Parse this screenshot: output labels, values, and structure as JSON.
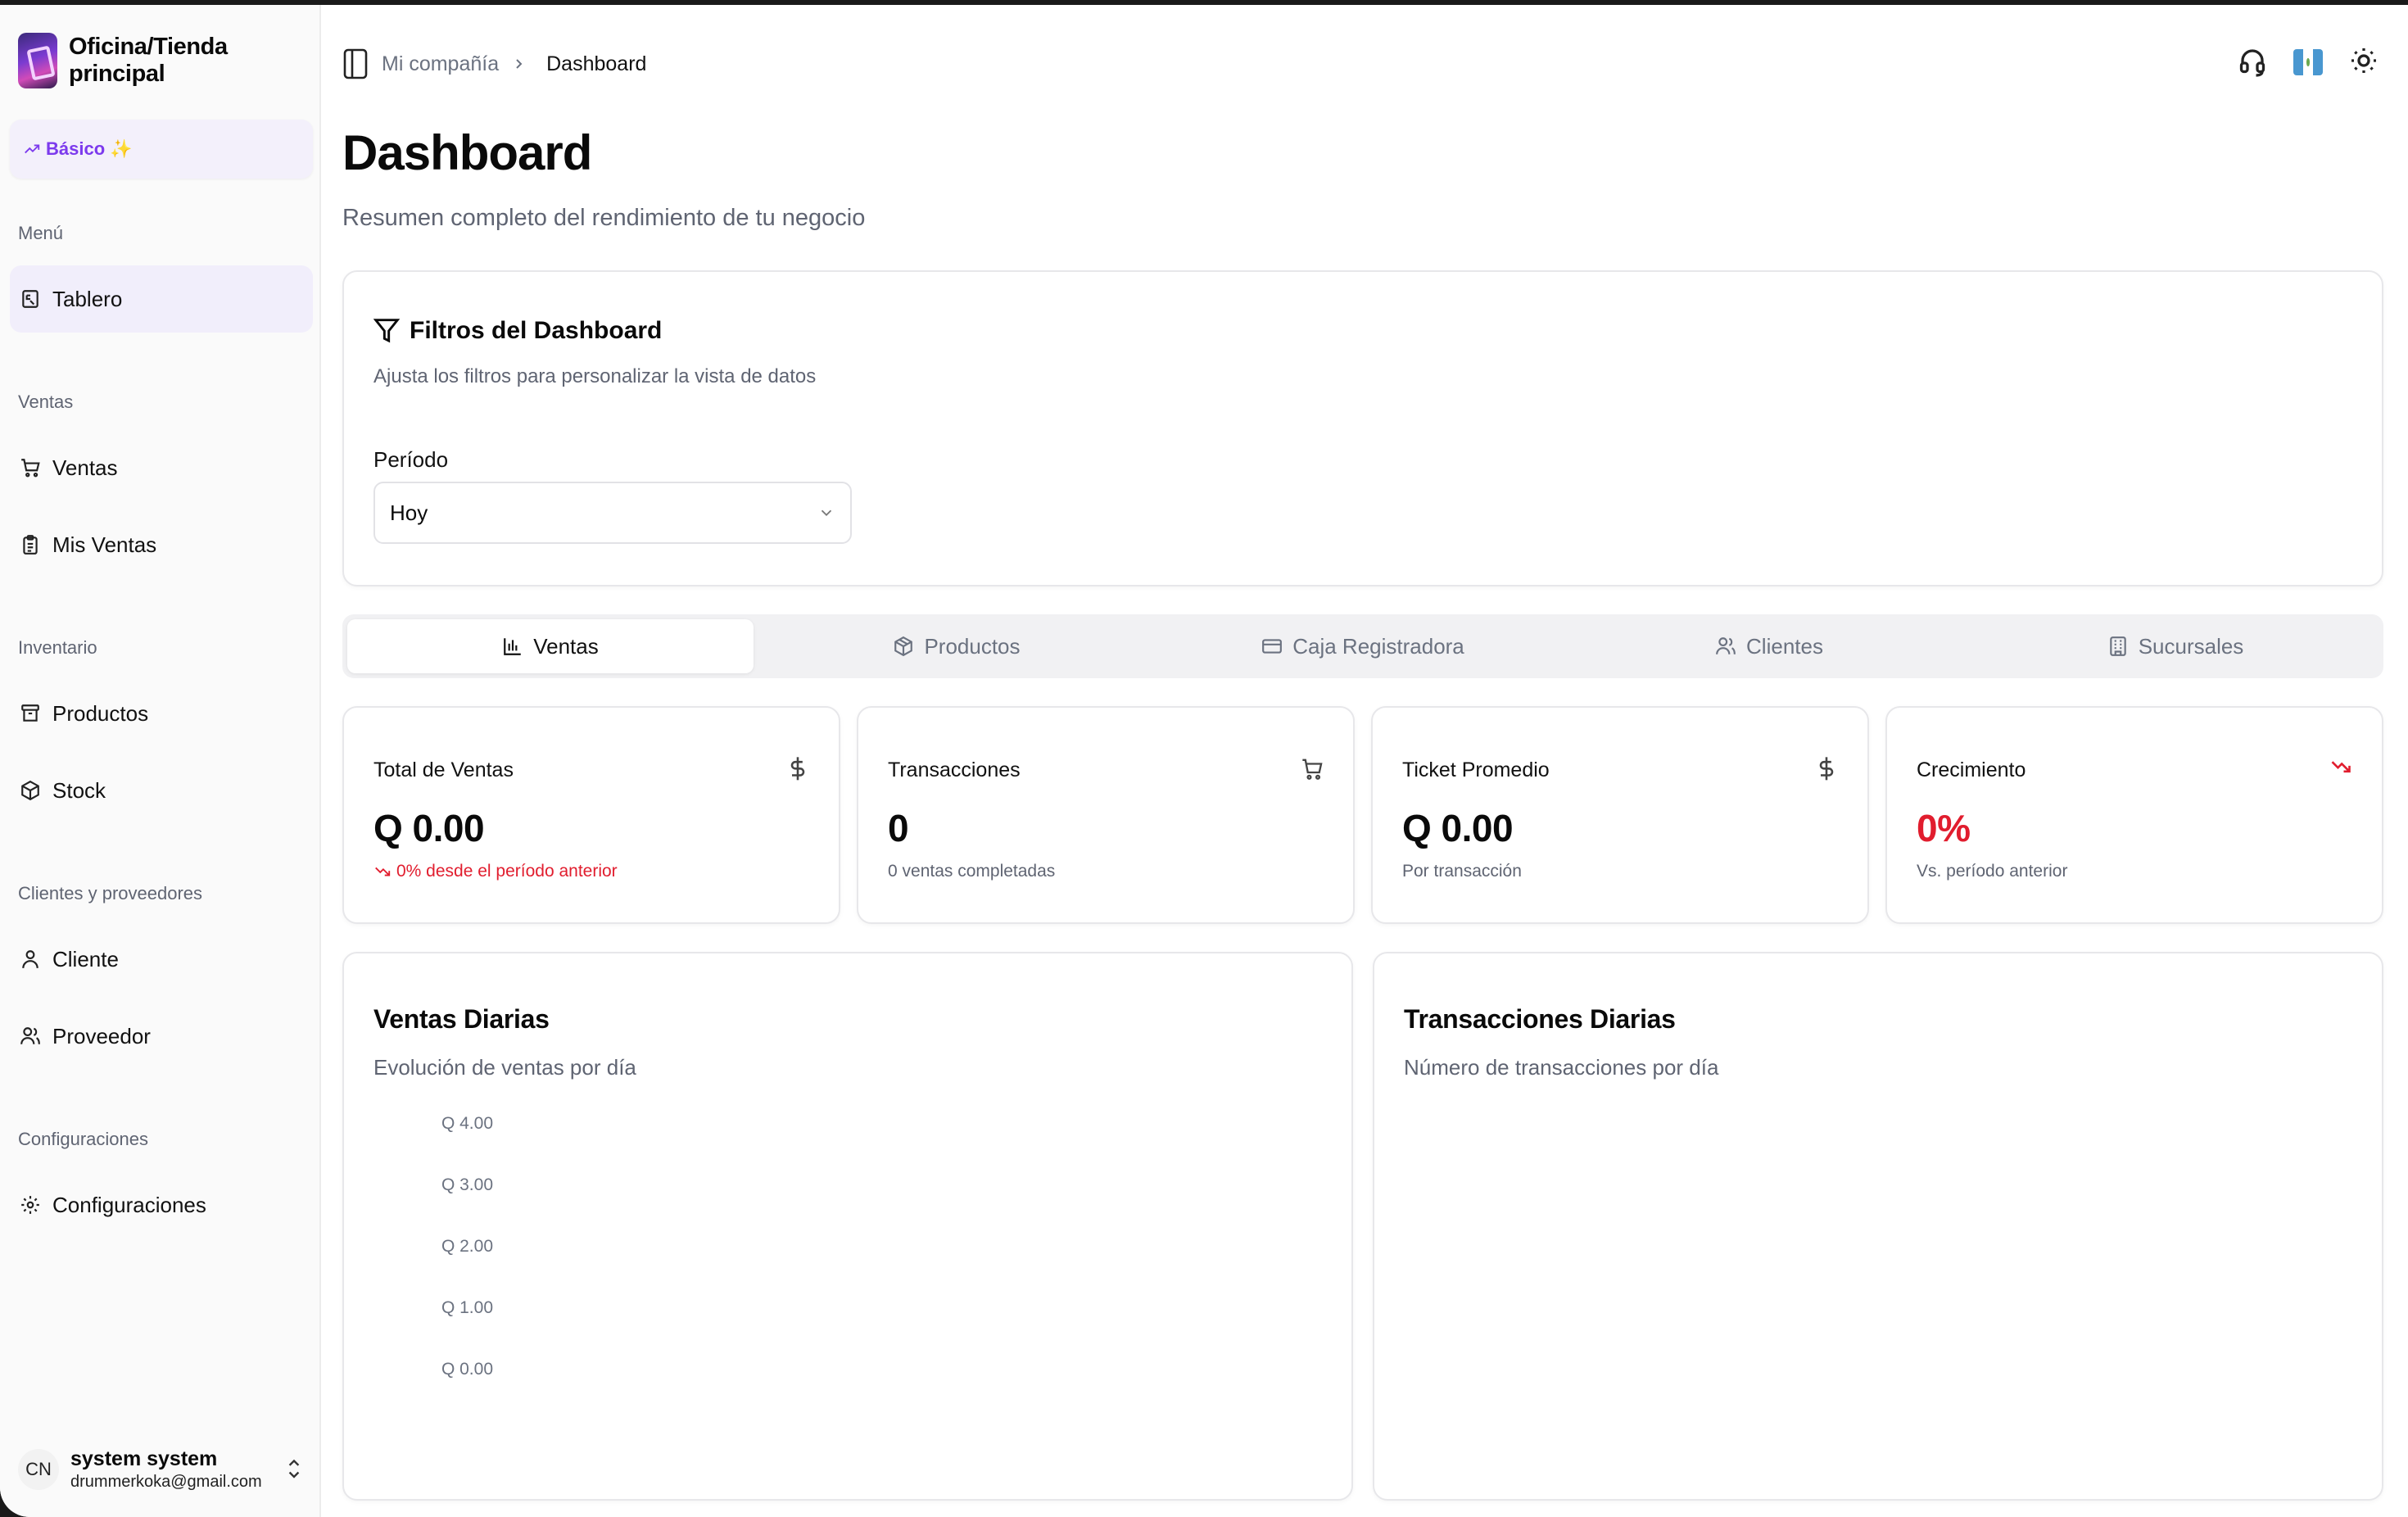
{
  "sidebar": {
    "brand": "Oficina/Tienda principal",
    "plan": "Básico",
    "plan_sparkle": "✨",
    "sections": [
      {
        "label": "Menú",
        "items": [
          {
            "label": "Tablero",
            "icon": "dashboard-icon"
          }
        ]
      },
      {
        "label": "Ventas",
        "items": [
          {
            "label": "Ventas",
            "icon": "cart-icon"
          },
          {
            "label": "Mis Ventas",
            "icon": "clipboard-icon"
          }
        ]
      },
      {
        "label": "Inventario",
        "items": [
          {
            "label": "Productos",
            "icon": "archive-icon"
          },
          {
            "label": "Stock",
            "icon": "box-icon"
          }
        ]
      },
      {
        "label": "Clientes y proveedores",
        "items": [
          {
            "label": "Cliente",
            "icon": "user-icon"
          },
          {
            "label": "Proveedor",
            "icon": "users-icon"
          }
        ]
      },
      {
        "label": "Configuraciones",
        "items": [
          {
            "label": "Configuraciones",
            "icon": "gear-icon"
          }
        ]
      }
    ],
    "user": {
      "initials": "CN",
      "name": "system system",
      "email": "drummerkoka@gmail.com"
    }
  },
  "header": {
    "breadcrumb": [
      "Mi compañía",
      "Dashboard"
    ],
    "icons": [
      "headset-icon",
      "guatemala-flag-icon",
      "sun-icon"
    ]
  },
  "page": {
    "title": "Dashboard",
    "subtitle": "Resumen completo del rendimiento de tu negocio"
  },
  "filters": {
    "title": "Filtros del Dashboard",
    "subtitle": "Ajusta los filtros para personalizar la vista de datos",
    "period_label": "Período",
    "period_value": "Hoy"
  },
  "tabs": [
    "Ventas",
    "Productos",
    "Caja Registradora",
    "Clientes",
    "Sucursales"
  ],
  "active_tab": "Ventas",
  "stats": [
    {
      "label": "Total de Ventas",
      "value": "Q 0.00",
      "note": "0% desde el período anterior",
      "icon": "dollar-icon"
    },
    {
      "label": "Transacciones",
      "value": "0",
      "note": "0 ventas completadas",
      "icon": "cart-icon"
    },
    {
      "label": "Ticket Promedio",
      "value": "Q 0.00",
      "note": "Por transacción",
      "icon": "dollar-icon"
    },
    {
      "label": "Crecimiento",
      "value": "0%",
      "note": "Vs. período anterior",
      "icon": "trend-down-icon"
    }
  ],
  "colors": {
    "accent": "#7c3aed",
    "negative": "#e11d2e",
    "muted": "#5f6472"
  },
  "charts": {
    "ventas": {
      "title": "Ventas Diarias",
      "subtitle": "Evolución de ventas por día",
      "y_ticks": [
        "Q 4.00",
        "Q 3.00",
        "Q 2.00",
        "Q 1.00",
        "Q 0.00"
      ]
    },
    "transacciones": {
      "title": "Transacciones Diarias",
      "subtitle": "Número de transacciones por día"
    }
  }
}
